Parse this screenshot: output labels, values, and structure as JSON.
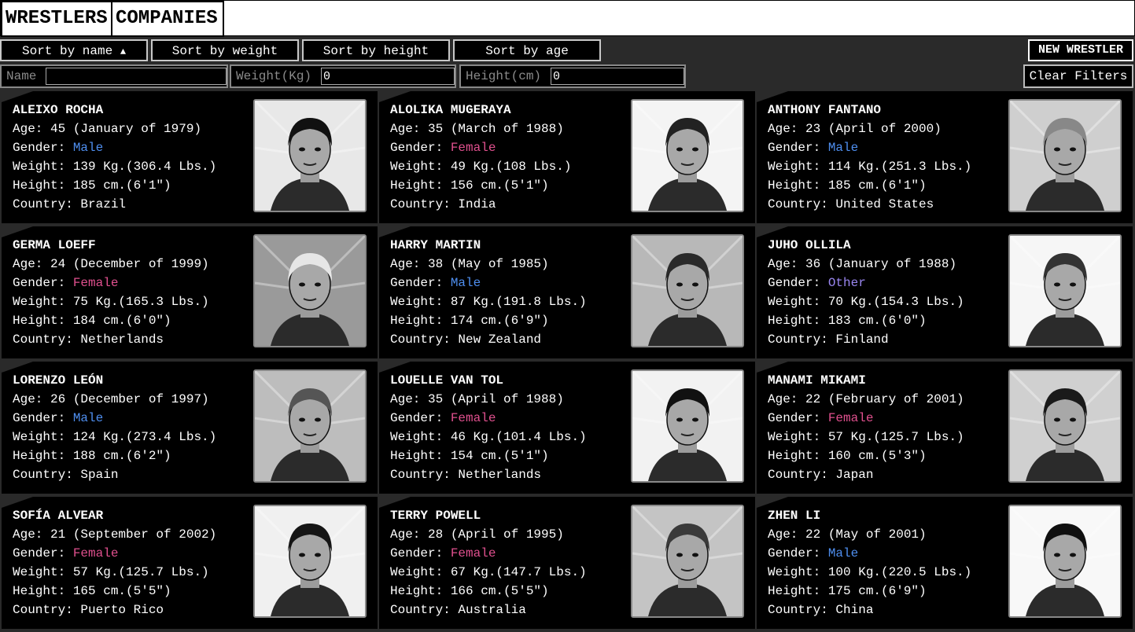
{
  "nav": {
    "tab1": "WRESTLERS",
    "tab2": "COMPANIES"
  },
  "toolbar": {
    "sort_name": "Sort by name",
    "sort_name_arrow": "▲",
    "sort_weight": "Sort by weight",
    "sort_height": "Sort by height",
    "sort_age": "Sort by age",
    "new_wrestler": "NEW WRESTLER",
    "clear_filters": "Clear Filters"
  },
  "filters": {
    "name_label": "Name",
    "name_value": "",
    "weight_label": "Weight(Kg)",
    "weight_value": "0",
    "height_label": "Height(cm)",
    "height_value": "0"
  },
  "colors": {
    "male": "#4f8ff0",
    "female": "#e0508e",
    "other": "#9a86f0"
  },
  "wrestlers": [
    {
      "name": "ALEIXO ROCHA",
      "age": "Age: 45 (January of 1979)",
      "gender_label": "Gender: ",
      "gender": "Male",
      "weight": "Weight: 139 Kg.(306.4 Lbs.)",
      "height": "Height: 185 cm.(6'1\")",
      "country": "Country: Brazil",
      "photo_icon": "wrestler-portrait-bearded-man"
    },
    {
      "name": "ALOLIKA MUGERAYA",
      "age": "Age: 35 (March of 1988)",
      "gender_label": "Gender: ",
      "gender": "Female",
      "weight": "Weight: 49 Kg.(108 Lbs.)",
      "height": "Height: 156 cm.(5'1\")",
      "country": "Country: India",
      "photo_icon": "wrestler-portrait-woman-short-hair"
    },
    {
      "name": "ANTHONY FANTANO",
      "age": "Age: 23 (April of 2000)",
      "gender_label": "Gender: ",
      "gender": "Male",
      "weight": "Weight: 114 Kg.(251.3 Lbs.)",
      "height": "Height: 185 cm.(6'1\")",
      "country": "Country: United States",
      "photo_icon": "wrestler-portrait-bald-bearded-man"
    },
    {
      "name": "GERMA LOEFF",
      "age": "Age: 24 (December of 1999)",
      "gender_label": "Gender: ",
      "gender": "Female",
      "weight": "Weight: 75 Kg.(165.3 Lbs.)",
      "height": "Height: 184 cm.(6'0\")",
      "country": "Country: Netherlands",
      "photo_icon": "wrestler-portrait-woman-long-hair"
    },
    {
      "name": "HARRY MARTIN",
      "age": "Age: 38 (May of 1985)",
      "gender_label": "Gender: ",
      "gender": "Male",
      "weight": "Weight: 87 Kg.(191.8 Lbs.)",
      "height": "Height: 174 cm.(6'9\")",
      "country": "Country: New Zealand",
      "photo_icon": "wrestler-portrait-masked-man"
    },
    {
      "name": "JUHO OLLILA",
      "age": "Age: 36 (January of 1988)",
      "gender_label": "Gender: ",
      "gender": "Other",
      "weight": "Weight: 70 Kg.(154.3 Lbs.)",
      "height": "Height: 183 cm.(6'0\")",
      "country": "Country: Finland",
      "photo_icon": "wrestler-portrait-undercut-hair"
    },
    {
      "name": "LORENZO LEÓN",
      "age": "Age: 26 (December of 1997)",
      "gender_label": "Gender: ",
      "gender": "Male",
      "weight": "Weight: 124 Kg.(273.4 Lbs.)",
      "height": "Height: 188 cm.(6'2\")",
      "country": "Country: Spain",
      "photo_icon": "wrestler-portrait-muscular-man"
    },
    {
      "name": "LOUELLE VAN TOL",
      "age": "Age: 35 (April of 1988)",
      "gender_label": "Gender: ",
      "gender": "Female",
      "weight": "Weight: 46 Kg.(101.4 Lbs.)",
      "height": "Height: 154 cm.(5'1\")",
      "country": "Country: Netherlands",
      "photo_icon": "wrestler-portrait-wild-hair-woman"
    },
    {
      "name": "MANAMI MIKAMI",
      "age": "Age: 22 (February of 2001)",
      "gender_label": "Gender: ",
      "gender": "Female",
      "weight": "Weight: 57 Kg.(125.7 Lbs.)",
      "height": "Height: 160 cm.(5'3\")",
      "country": "Country: Japan",
      "photo_icon": "wrestler-portrait-woman-bob-hair"
    },
    {
      "name": "SOFÍA ALVEAR",
      "age": "Age: 21 (September of 2002)",
      "gender_label": "Gender: ",
      "gender": "Female",
      "weight": "Weight: 57 Kg.(125.7 Lbs.)",
      "height": "Height: 165 cm.(5'5\")",
      "country": "Country: Puerto Rico",
      "photo_icon": "wrestler-portrait-woman-braids"
    },
    {
      "name": "TERRY POWELL",
      "age": "Age: 28 (April of 1995)",
      "gender_label": "Gender: ",
      "gender": "Female",
      "weight": "Weight: 67 Kg.(147.7 Lbs.)",
      "height": "Height: 166 cm.(5'5\")",
      "country": "Country: Australia",
      "photo_icon": "wrestler-portrait-woman-messy-hair"
    },
    {
      "name": "ZHEN LI",
      "age": "Age: 22 (May of 2001)",
      "gender_label": "Gender: ",
      "gender": "Male",
      "weight": "Weight: 100 Kg.(220.5 Lbs.)",
      "height": "Height: 175 cm.(6'9\")",
      "country": "Country: China",
      "photo_icon": "wrestler-portrait-long-hair-man"
    }
  ]
}
